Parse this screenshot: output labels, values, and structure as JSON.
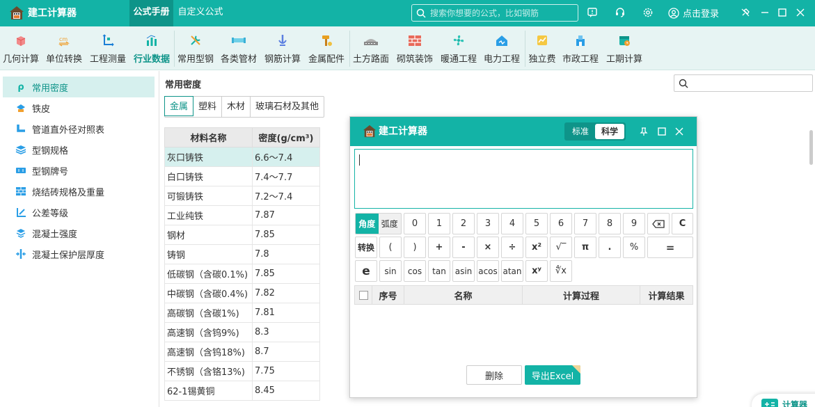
{
  "titlebar": {
    "app_name": "建工计算器",
    "tabs": [
      "公式手册",
      "自定义公式"
    ],
    "search_placeholder": "搜索你想要的公式，比如钢筋",
    "login": "点击登录"
  },
  "toolbar": {
    "items": [
      "几何计算",
      "单位转换",
      "工程测量",
      "行业数据",
      "常用型钢",
      "各类管材",
      "钢筋计算",
      "金属配件",
      "土方路面",
      "砌筑装饰",
      "暖通工程",
      "电力工程",
      "独立费",
      "市政工程",
      "工期计算"
    ],
    "active": "行业数据"
  },
  "sidebar": {
    "items": [
      "常用密度",
      "铁皮",
      "管道直外径对照表",
      "型钢规格",
      "型钢牌号",
      "烧结砖规格及重量",
      "公差等级",
      "混凝土强度",
      "混凝土保护层厚度"
    ]
  },
  "main": {
    "title": "常用密度",
    "tabs": [
      "金属",
      "塑料",
      "木材",
      "玻璃石材及其他"
    ],
    "table": {
      "headers": [
        "材料名称",
        "密度(g/cm³)"
      ],
      "rows": [
        [
          "灰口铸铁",
          "6.6～7.4"
        ],
        [
          "白口铸铁",
          "7.4～7.7"
        ],
        [
          "可锻铸铁",
          "7.2～7.4"
        ],
        [
          "工业纯铁",
          "7.87"
        ],
        [
          "钢材",
          "7.85"
        ],
        [
          "铸钢",
          "7.8"
        ],
        [
          "低碳钢（含碳0.1%)",
          "7.85"
        ],
        [
          "中碳钢（含碳0.4%)",
          "7.82"
        ],
        [
          "高碳钢（含碳1%)",
          "7.81"
        ],
        [
          "高速钢（含钨9%)",
          "8.3"
        ],
        [
          "高速钢（含钨18%)",
          "8.7"
        ],
        [
          "不锈钢（含铬13%)",
          "7.75"
        ],
        [
          "62-1锡黄铜",
          "8.45"
        ]
      ]
    }
  },
  "calculator": {
    "title": "建工计算器",
    "modes": [
      "标准",
      "科学"
    ],
    "active_mode": "科学",
    "keys": {
      "angle": "角度",
      "radian": "弧度",
      "digits": [
        "0",
        "1",
        "2",
        "3",
        "4",
        "5",
        "6",
        "7",
        "8",
        "9"
      ],
      "clear": "C",
      "convert": "转换",
      "lparen": "(",
      "rparen": ")",
      "plus": "+",
      "minus": "-",
      "times": "×",
      "divide": "÷",
      "square": "x²",
      "sqrt": "√‾",
      "pi": "π",
      "dot": ".",
      "percent": "%",
      "equals": "=",
      "e": "e",
      "sin": "sin",
      "cos": "cos",
      "tan": "tan",
      "asin": "asin",
      "acos": "acos",
      "atan": "atan",
      "power": "xʸ",
      "root": "∜x"
    },
    "history_headers": [
      "序号",
      "名称",
      "计算过程",
      "计算结果"
    ],
    "delete": "删除",
    "export": "导出Excel"
  },
  "badge": "计算器",
  "colors": {
    "primary": "#13b3a6",
    "primary_dark": "#0e9489",
    "highlight": "#d6f0ee"
  }
}
